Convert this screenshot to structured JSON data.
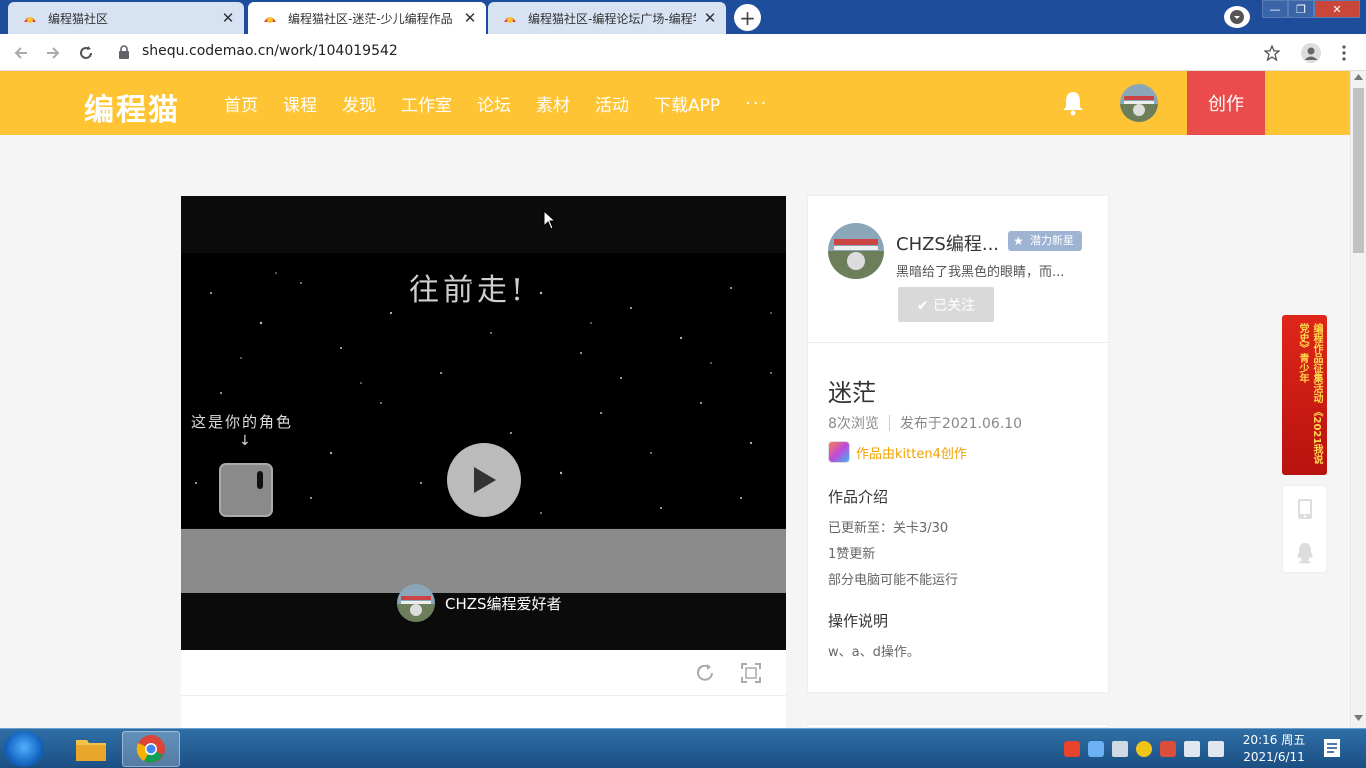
{
  "browser": {
    "tabs": [
      {
        "title": "编程猫社区",
        "active": false
      },
      {
        "title": "编程猫社区-迷茫-少儿编程作品",
        "active": true
      },
      {
        "title": "编程猫社区-编程论坛广场-编程学",
        "active": false
      }
    ],
    "url": "shequ.codemao.cn/work/104019542"
  },
  "site": {
    "logo": "编程猫",
    "nav": [
      "首页",
      "课程",
      "发现",
      "工作室",
      "论坛",
      "素材",
      "活动",
      "下载APP",
      "···"
    ],
    "create_label": "创作",
    "accent_color": "#fec433",
    "create_color": "#ea4b4b"
  },
  "player": {
    "stage_title": "往前走!",
    "role_label": "这是你的角色",
    "role_arrow": "↓",
    "author_name": "CHZS编程爱好者"
  },
  "author_card": {
    "name": "CHZS编程...",
    "badge": "潜力新星",
    "signature": "黑暗给了我黑色的眼睛，而...",
    "follow_label": "✔ 已关注"
  },
  "work": {
    "title": "迷茫",
    "views": "8次浏览",
    "published": "发布于2021.06.10",
    "made_with": "作品由kitten4创作",
    "intro_heading": "作品介绍",
    "intro_lines": [
      "已更新至：关卡3/30",
      "1赞更新",
      "部分电脑可能不能运行"
    ],
    "ops_heading": "操作说明",
    "ops_text": "w、a、d操作。"
  },
  "float_banner": {
    "text": "编程作品征集活动 《2021我说党史》青少年"
  },
  "taskbar": {
    "time": "20:16 周五",
    "date": "2021/6/11"
  }
}
